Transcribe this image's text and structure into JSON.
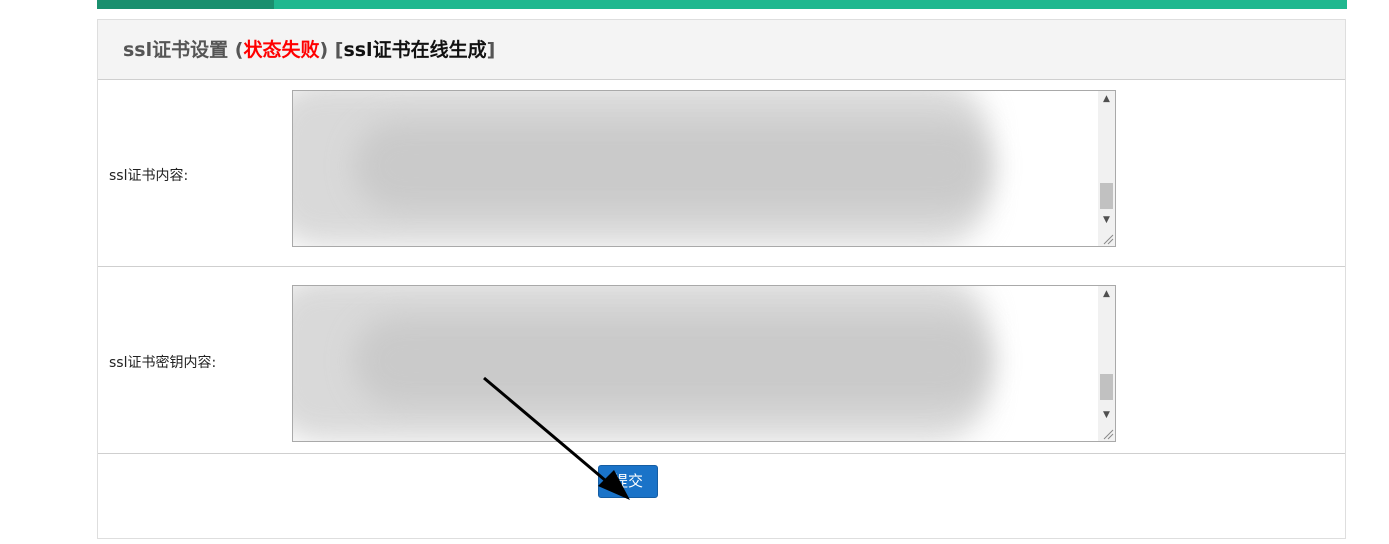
{
  "header": {
    "title_prefix": "ssl证书设置 (",
    "status_text": "状态失败",
    "title_mid": ") [",
    "online_link": "ssl证书在线生成",
    "title_suffix": "]"
  },
  "form": {
    "cert_label": "ssl证书内容:",
    "key_label": "ssl证书密钥内容:",
    "submit_label": "提交"
  },
  "colors": {
    "accent_green": "#1fb88f",
    "status_fail": "#ff0000",
    "submit_blue": "#1a73c8"
  }
}
